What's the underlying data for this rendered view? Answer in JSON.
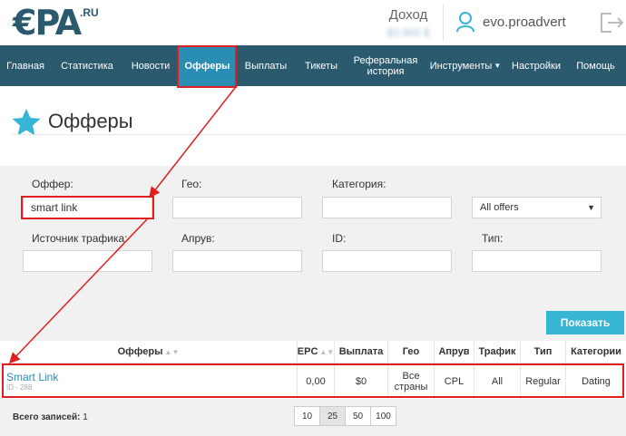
{
  "header": {
    "logo_text": "€PA",
    "logo_suffix": ".RU",
    "income_label": "Доход",
    "income_value": "$3,900 $",
    "username": "evo.proadvert"
  },
  "nav": {
    "items": [
      {
        "label": "Главная"
      },
      {
        "label": "Статистика"
      },
      {
        "label": "Новости"
      },
      {
        "label": "Офферы"
      },
      {
        "label": "Выплаты"
      },
      {
        "label": "Тикеты"
      },
      {
        "label": "Реферальная история"
      },
      {
        "label": "Инструменты"
      },
      {
        "label": "Настройки"
      },
      {
        "label": "Помощь"
      }
    ],
    "active_index": 3
  },
  "page": {
    "title": "Офферы"
  },
  "filters": {
    "offer_label": "Оффер:",
    "offer_value": "smart link",
    "geo_label": "Гео:",
    "category_label": "Категория:",
    "offer_type_select": "All offers",
    "traffic_label": "Источник трафика:",
    "approve_label": "Апрув:",
    "id_label": "ID:",
    "type_label": "Тип:"
  },
  "show_button": "Показать",
  "table": {
    "columns": [
      "Офферы",
      "EPC",
      "Выплата",
      "Гео",
      "Апрув",
      "Трафик",
      "Тип",
      "Категории"
    ],
    "rows": [
      {
        "name": "Smart Link",
        "id": "ID - 288",
        "epc": "0,00",
        "payout": "$0",
        "geo": "Все страны",
        "approve": "CPL",
        "traffic": "All",
        "type": "Regular",
        "category": "Dating"
      }
    ]
  },
  "footer": {
    "total_label": "Всего записей:",
    "total_value": "1",
    "page_sizes": [
      "10",
      "25",
      "50",
      "100"
    ],
    "active_page_size": "25"
  },
  "colors": {
    "nav_bg": "#2b5a6e",
    "nav_active": "#2a8db4",
    "accent_button": "#37b5d4",
    "annotation_red": "#e02020",
    "link": "#2a8db4"
  }
}
